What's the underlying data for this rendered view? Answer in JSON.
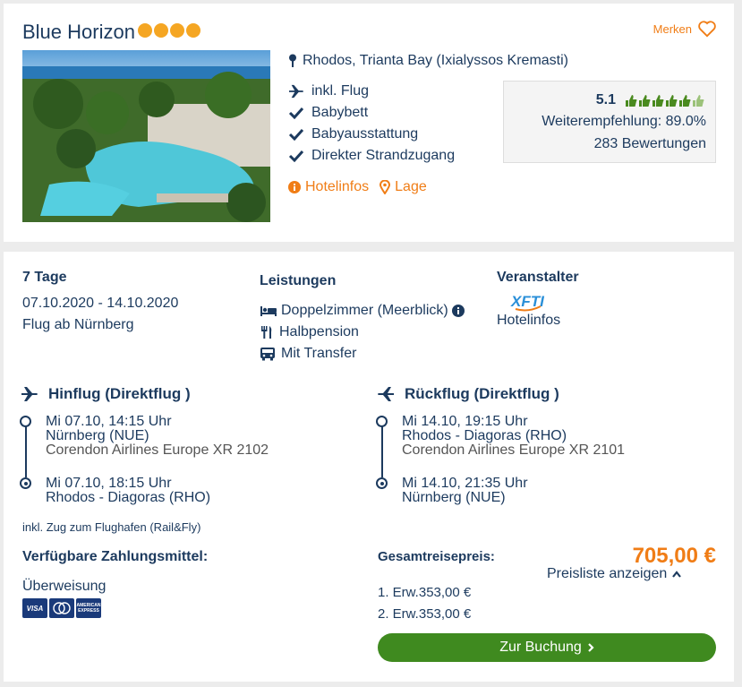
{
  "hotel": {
    "name": "Blue Horizon",
    "stars": 4,
    "bookmark_label": "Merken",
    "location": "Rhodos, Trianta Bay (Ixialyssos Kremasti)",
    "features": [
      "inkl. Flug",
      "Babybett",
      "Babyausstattung",
      "Direkter Strandzugang"
    ],
    "links": {
      "hotelinfos": "Hotelinfos",
      "lage": "Lage"
    },
    "rating": {
      "score": "5.1",
      "thumbs_total": 6,
      "recommendation": "Weiterempfehlung: 89.0%",
      "reviews": "283 Bewertungen"
    }
  },
  "offer": {
    "duration": "7 Tage",
    "dates": "07.10.2020 - 14.10.2020",
    "departure": "Flug ab Nürnberg",
    "services_title": "Leistungen",
    "services": [
      "Doppelzimmer (Meerblick)",
      "Halbpension",
      "Mit Transfer"
    ],
    "operator_title": "Veranstalter",
    "operator_logo": "XFTI",
    "operator_link": "Hotelinfos",
    "outbound": {
      "title": "Hinflug (Direktflug )",
      "dep_time": "Mi 07.10, 14:15 Uhr",
      "dep_airport": "Nürnberg (NUE)",
      "airline": "Corendon Airlines Europe XR 2102",
      "arr_time": "Mi 07.10, 18:15 Uhr",
      "arr_airport": "Rhodos - Diagoras (RHO)"
    },
    "return": {
      "title": "Rückflug (Direktflug )",
      "dep_time": "Mi 14.10, 19:15 Uhr",
      "dep_airport": "Rhodos - Diagoras (RHO)",
      "airline": "Corendon Airlines Europe XR 2101",
      "arr_time": "Mi 14.10, 21:35 Uhr",
      "arr_airport": "Nürnberg (NUE)"
    },
    "rail_fly": "inkl. Zug zum Flughafen (Rail&Fly)",
    "payment_title": "Verfügbare Zahlungsmittel:",
    "payment_method": "Überweisung",
    "cards": [
      "VISA",
      "Mastercard",
      "American Express"
    ],
    "total_label": "Gesamtreisepreis:",
    "total_price": "705,00 €",
    "price_list_label": "Preisliste anzeigen",
    "travellers": [
      "1. Erw.353,00 €",
      "2. Erw.353,00 €"
    ],
    "book_label": "Zur Buchung"
  },
  "colors": {
    "navy": "#1c3a5e",
    "orange": "#f07d16",
    "green": "#3f8a1f",
    "star": "#f5a623"
  }
}
